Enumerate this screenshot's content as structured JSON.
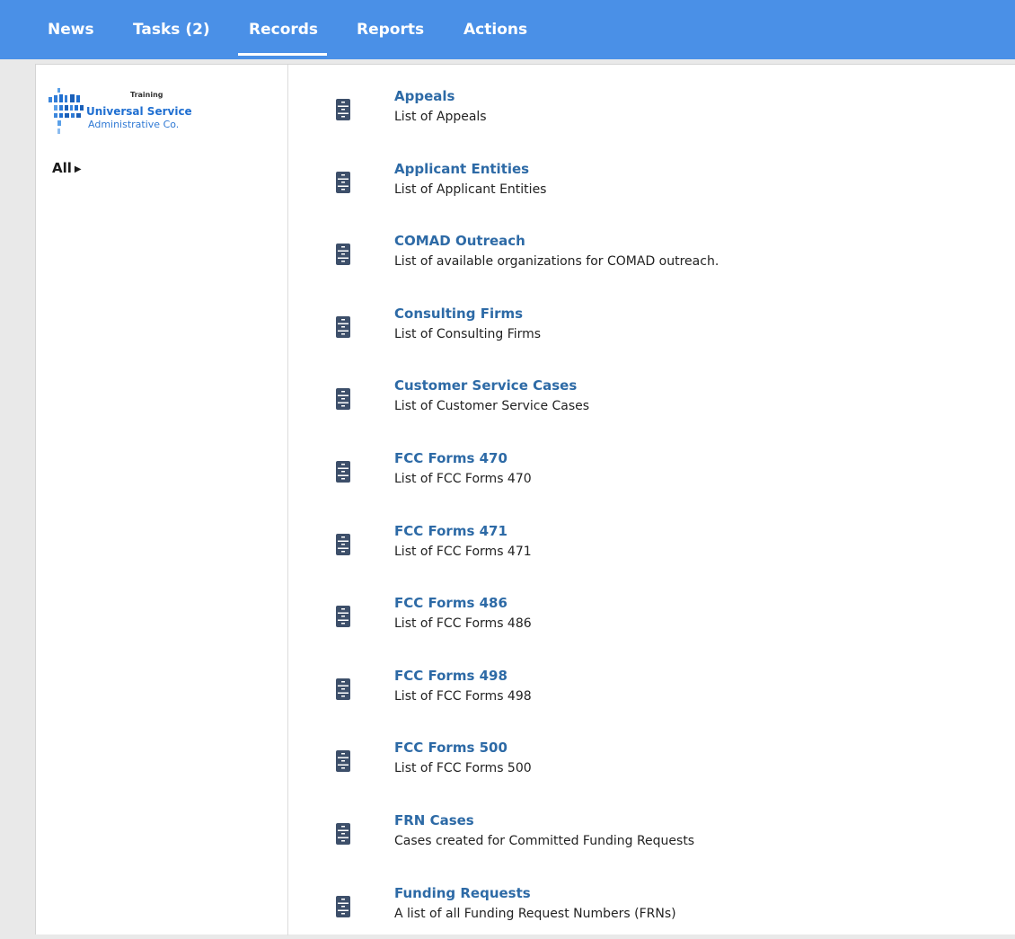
{
  "nav": {
    "tabs": [
      {
        "label": "News"
      },
      {
        "label": "Tasks (2)"
      },
      {
        "label": "Records"
      },
      {
        "label": "Reports"
      },
      {
        "label": "Actions"
      }
    ],
    "active": "Records"
  },
  "logo": {
    "training": "Training",
    "line1": "Universal Service",
    "line2": "Administrative Co."
  },
  "sidebar": {
    "all_label": "All"
  },
  "records": [
    {
      "title": "Appeals",
      "description": "List of Appeals"
    },
    {
      "title": "Applicant Entities",
      "description": "List of Applicant Entities"
    },
    {
      "title": "COMAD Outreach",
      "description": "List of available organizations for COMAD outreach."
    },
    {
      "title": "Consulting Firms",
      "description": "List of Consulting Firms"
    },
    {
      "title": "Customer Service Cases",
      "description": "List of Customer Service Cases"
    },
    {
      "title": "FCC Forms 470",
      "description": "List of FCC Forms 470"
    },
    {
      "title": "FCC Forms 471",
      "description": "List of FCC Forms 471"
    },
    {
      "title": "FCC Forms 486",
      "description": "List of FCC Forms 486"
    },
    {
      "title": "FCC Forms 498",
      "description": "List of FCC Forms 498"
    },
    {
      "title": "FCC Forms 500",
      "description": "List of FCC Forms 500"
    },
    {
      "title": "FRN Cases",
      "description": "Cases created for Committed Funding Requests"
    },
    {
      "title": "Funding Requests",
      "description": "A list of all Funding Request Numbers (FRNs)"
    }
  ],
  "colors": {
    "nav_bg": "#4a90e7",
    "link": "#2d6aa6",
    "icon": "#3d4f6a"
  }
}
